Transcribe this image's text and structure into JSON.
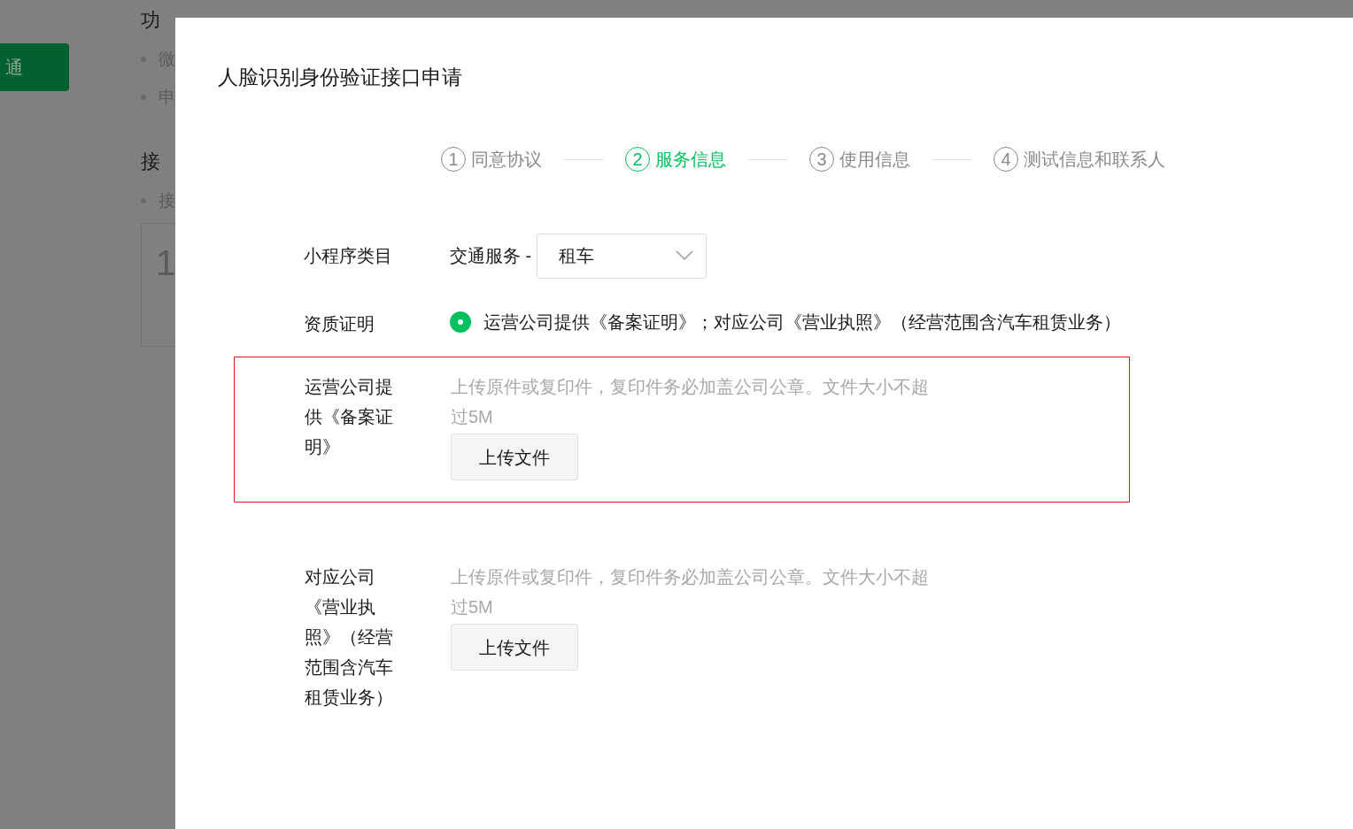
{
  "background": {
    "button": "通",
    "sections": [
      {
        "heading": "功",
        "bullets": [
          "微",
          "申"
        ]
      },
      {
        "heading": "接",
        "bullets": [
          "接"
        ],
        "box_text": "1"
      }
    ]
  },
  "dialog": {
    "title": "人脸识别身份验证接口申请",
    "steps": [
      {
        "number": "1",
        "label": "同意协议",
        "selected": false
      },
      {
        "number": "2",
        "label": "服务信息",
        "selected": true
      },
      {
        "number": "3",
        "label": "使用信息",
        "selected": false
      },
      {
        "number": "4",
        "label": "测试信息和联系人",
        "selected": false
      }
    ],
    "fields": [
      {
        "kind": "select",
        "label": "小程序类目",
        "prefix": "交通服务 -",
        "value": "租车"
      },
      {
        "kind": "radio",
        "label": "资质证明",
        "options": [
          {
            "label": "运营公司提供《备案证明》；对应公司《营业执照》（经营范围含汽车租赁业务）",
            "selected": true
          }
        ]
      },
      {
        "kind": "upload",
        "label": "运营公司提供《备案证明》",
        "hint": "上传原件或复印件，复印件务必加盖公司公章。文件大小不超过5M",
        "button": "上传文件",
        "highlighted": true
      },
      {
        "kind": "upload",
        "label": "对应公司《营业执照》（经营范围含汽车租赁业务）",
        "hint": "上传原件或复印件，复印件务必加盖公司公章。文件大小不超过5M",
        "button": "上传文件",
        "highlighted": false
      }
    ]
  }
}
